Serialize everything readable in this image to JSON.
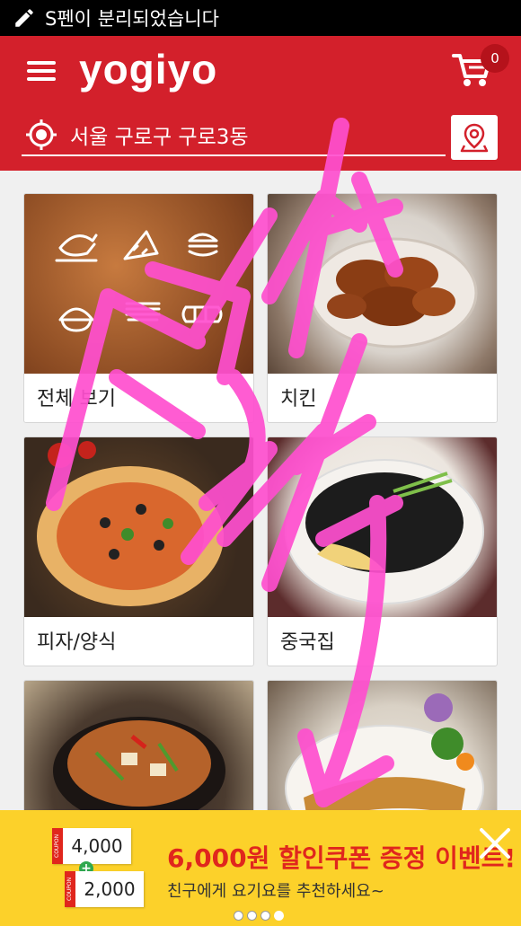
{
  "status_bar": {
    "text": "S펜이 분리되었습니다"
  },
  "header": {
    "logo": "yogiyo",
    "cart_count": "0"
  },
  "location": {
    "address": "서울 구로구 구로3동"
  },
  "categories": [
    {
      "label": "전체 보기"
    },
    {
      "label": "치킨"
    },
    {
      "label": "피자/양식"
    },
    {
      "label": "중국집"
    },
    {
      "label": ""
    },
    {
      "label": ""
    }
  ],
  "banner": {
    "coupon1": "4,000",
    "coupon2": "2,000",
    "coupon_tag": "COUPON",
    "title": "6,000원 할인쿠폰 증정 이벤트!",
    "subtitle": "친구에게 요기요를 추천하세요~",
    "dots": 4,
    "active_dot": 3
  },
  "colors": {
    "brand_red": "#d3202b",
    "banner_yellow": "#fcd12a",
    "scribble_pink": "#ff4fcf"
  }
}
